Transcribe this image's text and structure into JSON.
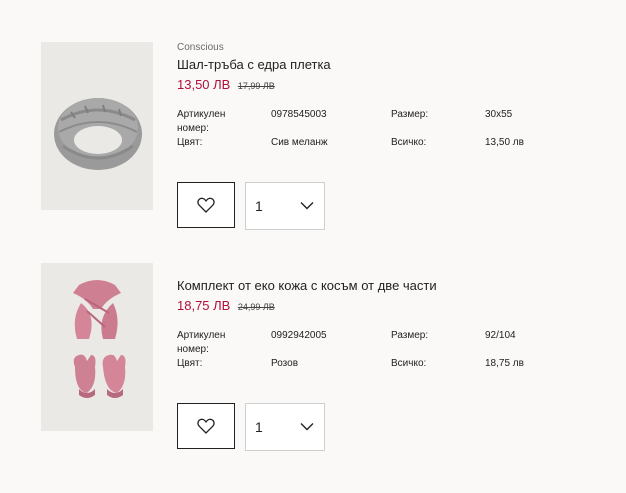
{
  "items": [
    {
      "tag": "Conscious",
      "title": "Шал-тръба с едра плетка",
      "price": "13,50 ЛВ",
      "old_price": "17,99 ЛВ",
      "attributes": {
        "article_label": "Артикулен номер:",
        "article_value": "0978545003",
        "size_label": "Размер:",
        "size_value": "30x55",
        "color_label": "Цвят:",
        "color_value": "Сив меланж",
        "total_label": "Всичко:",
        "total_value": "13,50 лв"
      },
      "quantity": "1",
      "image": "grey-knit-snood"
    },
    {
      "tag": "",
      "title": "Комплект от еко кожа с косъм от две части",
      "price": "18,75 ЛВ",
      "old_price": "24,99 ЛВ",
      "attributes": {
        "article_label": "Артикулен номер:",
        "article_value": "0992942005",
        "size_label": "Размер:",
        "size_value": "92/104",
        "color_label": "Цвят:",
        "color_value": "Розов",
        "total_label": "Всичко:",
        "total_value": "18,75 лв"
      },
      "quantity": "1",
      "image": "pink-faux-fur-scarf-and-mittens"
    }
  ],
  "icons": {
    "favorite": "heart-icon",
    "dropdown": "chevron-down-icon"
  },
  "colors": {
    "price": "#b0103a",
    "background": "#faf9f8",
    "border_dark": "#222222",
    "border_light": "#cfcfcf"
  }
}
